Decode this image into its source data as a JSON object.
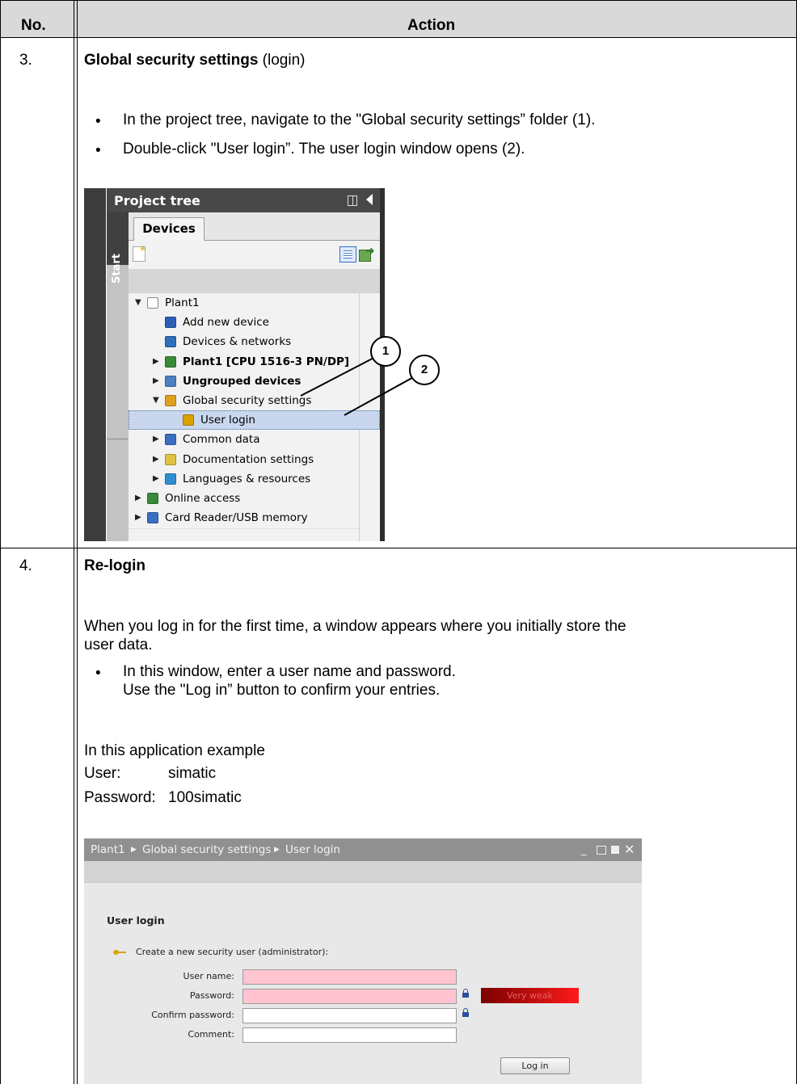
{
  "table": {
    "header": {
      "no": "No.",
      "action": "Action"
    },
    "rows": [
      {
        "no": "3.",
        "title": "Global security settings",
        "title_suffix": " (login)",
        "bullets": [
          "In the project tree, navigate to the \"Global security settings” folder (1).",
          "Double-click \"User login”. The user login window opens (2)."
        ]
      },
      {
        "no": "4.",
        "title": "Re-login",
        "paragraph_1": "When you log in for the first time, a window appears where you initially store the",
        "paragraph_2": "user data.",
        "bullet_1": "In this window, enter a user name and password.",
        "bullet_2": "Use the \"Log in” button to confirm your entries.",
        "example_intro": "In this application example",
        "user_label": "User:",
        "user_value": "simatic",
        "password_label": "Password:",
        "password_value": "100simatic"
      }
    ]
  },
  "project_tree": {
    "title": "Project tree",
    "tab": "Devices",
    "side_label": "Start",
    "callouts": [
      "1",
      "2"
    ],
    "items": [
      {
        "label": "Plant1",
        "icon": "project-icon",
        "expand": "expanded",
        "bold": false
      },
      {
        "label": "Add new device",
        "icon": "add-device-icon",
        "expand": "none",
        "bold": false
      },
      {
        "label": "Devices & networks",
        "icon": "network-icon",
        "expand": "none",
        "bold": false
      },
      {
        "label": "Plant1 [CPU 1516-3 PN/DP]",
        "icon": "cpu-icon",
        "expand": "collapsed",
        "bold": true
      },
      {
        "label": "Ungrouped devices",
        "icon": "devices-folder-icon",
        "expand": "collapsed",
        "bold": true
      },
      {
        "label": "Global security settings",
        "icon": "security-folder-icon",
        "expand": "expanded",
        "bold": false
      },
      {
        "label": "User login",
        "icon": "user-key-icon",
        "expand": "none",
        "bold": false,
        "selected": true
      },
      {
        "label": "Common data",
        "icon": "common-data-icon",
        "expand": "collapsed",
        "bold": false
      },
      {
        "label": "Documentation settings",
        "icon": "documentation-icon",
        "expand": "collapsed",
        "bold": false
      },
      {
        "label": "Languages & resources",
        "icon": "languages-icon",
        "expand": "collapsed",
        "bold": false
      },
      {
        "label": "Online access",
        "icon": "online-access-icon",
        "expand": "collapsed",
        "bold": false
      },
      {
        "label": "Card Reader/USB memory",
        "icon": "card-reader-icon",
        "expand": "collapsed",
        "bold": false
      }
    ]
  },
  "user_login_window": {
    "breadcrumb": [
      "Plant1",
      "Global security settings",
      "User login"
    ],
    "heading": "User login",
    "create_text": "Create a new security user (administrator):",
    "fields": [
      {
        "label": "User name:",
        "value": ""
      },
      {
        "label": "Password:",
        "value": ""
      },
      {
        "label": "Confirm password:",
        "value": ""
      },
      {
        "label": "Comment:",
        "value": ""
      }
    ],
    "strength": "Very weak",
    "login_button": "Log in",
    "colors": {
      "required_field": "#ffc4cf",
      "strength_bar": "#cc0000"
    }
  }
}
